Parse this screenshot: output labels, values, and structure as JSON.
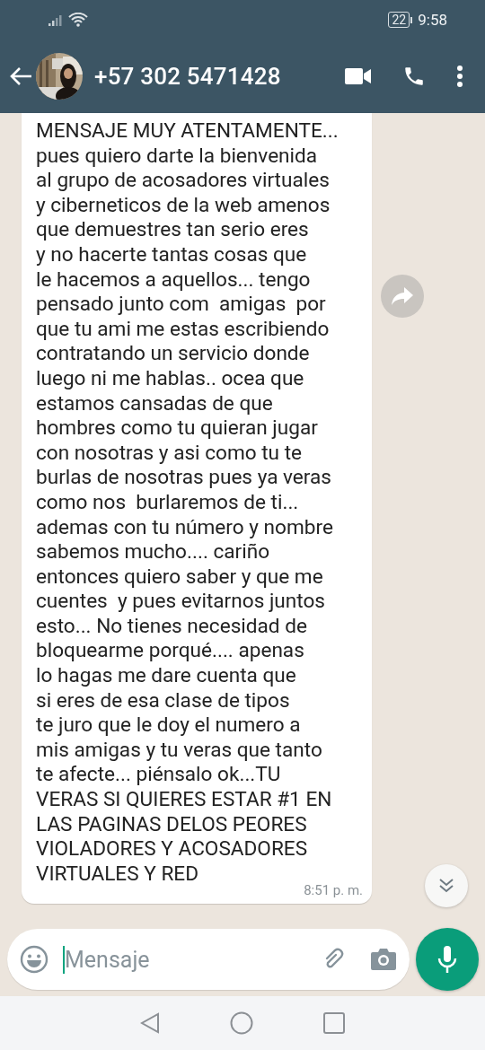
{
  "status_bar": {
    "battery": "22",
    "time": "9:58"
  },
  "header": {
    "contact": "+57 302 5471428"
  },
  "message": {
    "lines": [
      "MENSAJE MUY ATENTAMENTE...",
      "pues quiero darte la bienvenida",
      "al grupo de acosadores virtuales",
      "y ciberneticos de la web amenos",
      "que demuestres tan serio eres",
      "y no hacerte tantas cosas que",
      "le hacemos a aquellos... tengo",
      "pensado junto com  amigas  por",
      "que tu ami me estas escribiendo",
      "contratando un servicio donde",
      "luego ni me hablas.. ocea que",
      "estamos cansadas de que",
      "hombres como tu quieran jugar",
      "con nosotras y asi como tu te",
      "burlas de nosotras pues ya veras",
      "como nos  burlaremos de ti...",
      "ademas con tu número y nombre",
      "sabemos mucho.... cariño",
      "entonces quiero saber y que me",
      "cuentes  y pues evitarnos juntos",
      "esto... No tienes necesidad de",
      "bloquearme porqué.... apenas",
      "lo hagas me dare cuenta que",
      "si eres de esa clase de tipos",
      "te juro que le doy el numero a",
      "mis amigas y tu veras que tanto",
      "te afecte... piénsalo ok...TU",
      "VERAS SI QUIERES ESTAR #1 EN",
      "LAS PAGINAS DELOS PEORES",
      "VIOLADORES Y ACOSADORES",
      "VIRTUALES Y RED"
    ],
    "time": "8:51 p. m."
  },
  "composer": {
    "placeholder": "Mensaje"
  }
}
